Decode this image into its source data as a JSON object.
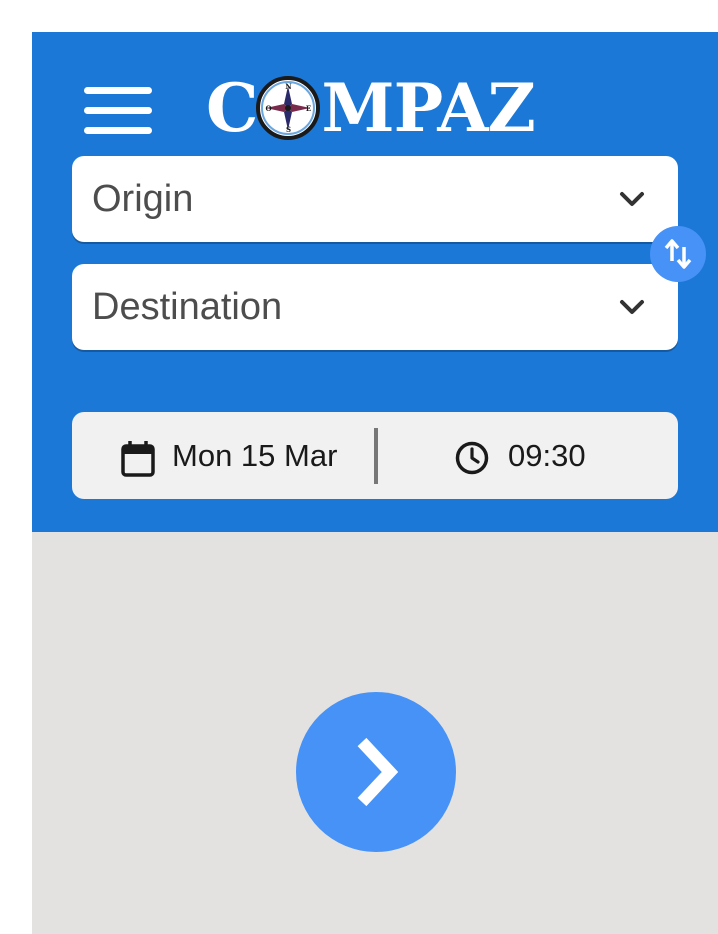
{
  "app": {
    "logo_text_before": "C",
    "logo_text_after": "MPAZ",
    "brand_color": "#1c78d6",
    "accent_color": "#4692f7",
    "compass_letters": {
      "n": "N",
      "s": "S",
      "e": "E",
      "o": "O"
    }
  },
  "menu": {
    "icon": "hamburger-menu-icon"
  },
  "origin": {
    "label": "Origin",
    "icon": "chevron-down-icon"
  },
  "destination": {
    "label": "Destination",
    "icon": "chevron-down-icon"
  },
  "swap": {
    "icon": "swap-vertical-icon"
  },
  "datetime": {
    "date": "Mon 15 Mar",
    "time": "09:30",
    "date_icon": "calendar-icon",
    "time_icon": "clock-icon"
  },
  "go": {
    "icon": "chevron-right-icon"
  }
}
